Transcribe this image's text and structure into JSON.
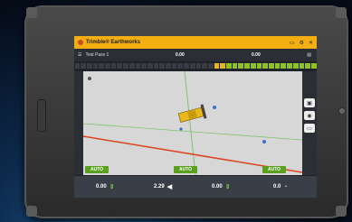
{
  "titlebar": {
    "app_title": "Trimble® Earthworks",
    "icons": [
      "folder-icon",
      "gear-icon",
      "close-icon"
    ]
  },
  "statusbar": {
    "design_name": "Test Pass 1",
    "value_left": "0.00",
    "value_right": "0.00"
  },
  "auto_buttons": [
    {
      "label": "AUTO"
    },
    {
      "label": "AUTO"
    },
    {
      "label": "AUTO"
    }
  ],
  "bottombar": {
    "cells": [
      {
        "value": "0.00",
        "icon": "up-down-arrow-icon"
      },
      {
        "value": "2.29",
        "icon": "left-arrow-icon"
      },
      {
        "value": "0.00",
        "icon": "up-down-arrow-icon"
      },
      {
        "value": "0.0",
        "icon": "gauge-icon"
      }
    ]
  },
  "colors": {
    "title_bar": "#f3ae12",
    "auto_green": "#5aa01e",
    "design_line_red": "#d9441f",
    "design_line_green": "#7fc26b"
  }
}
